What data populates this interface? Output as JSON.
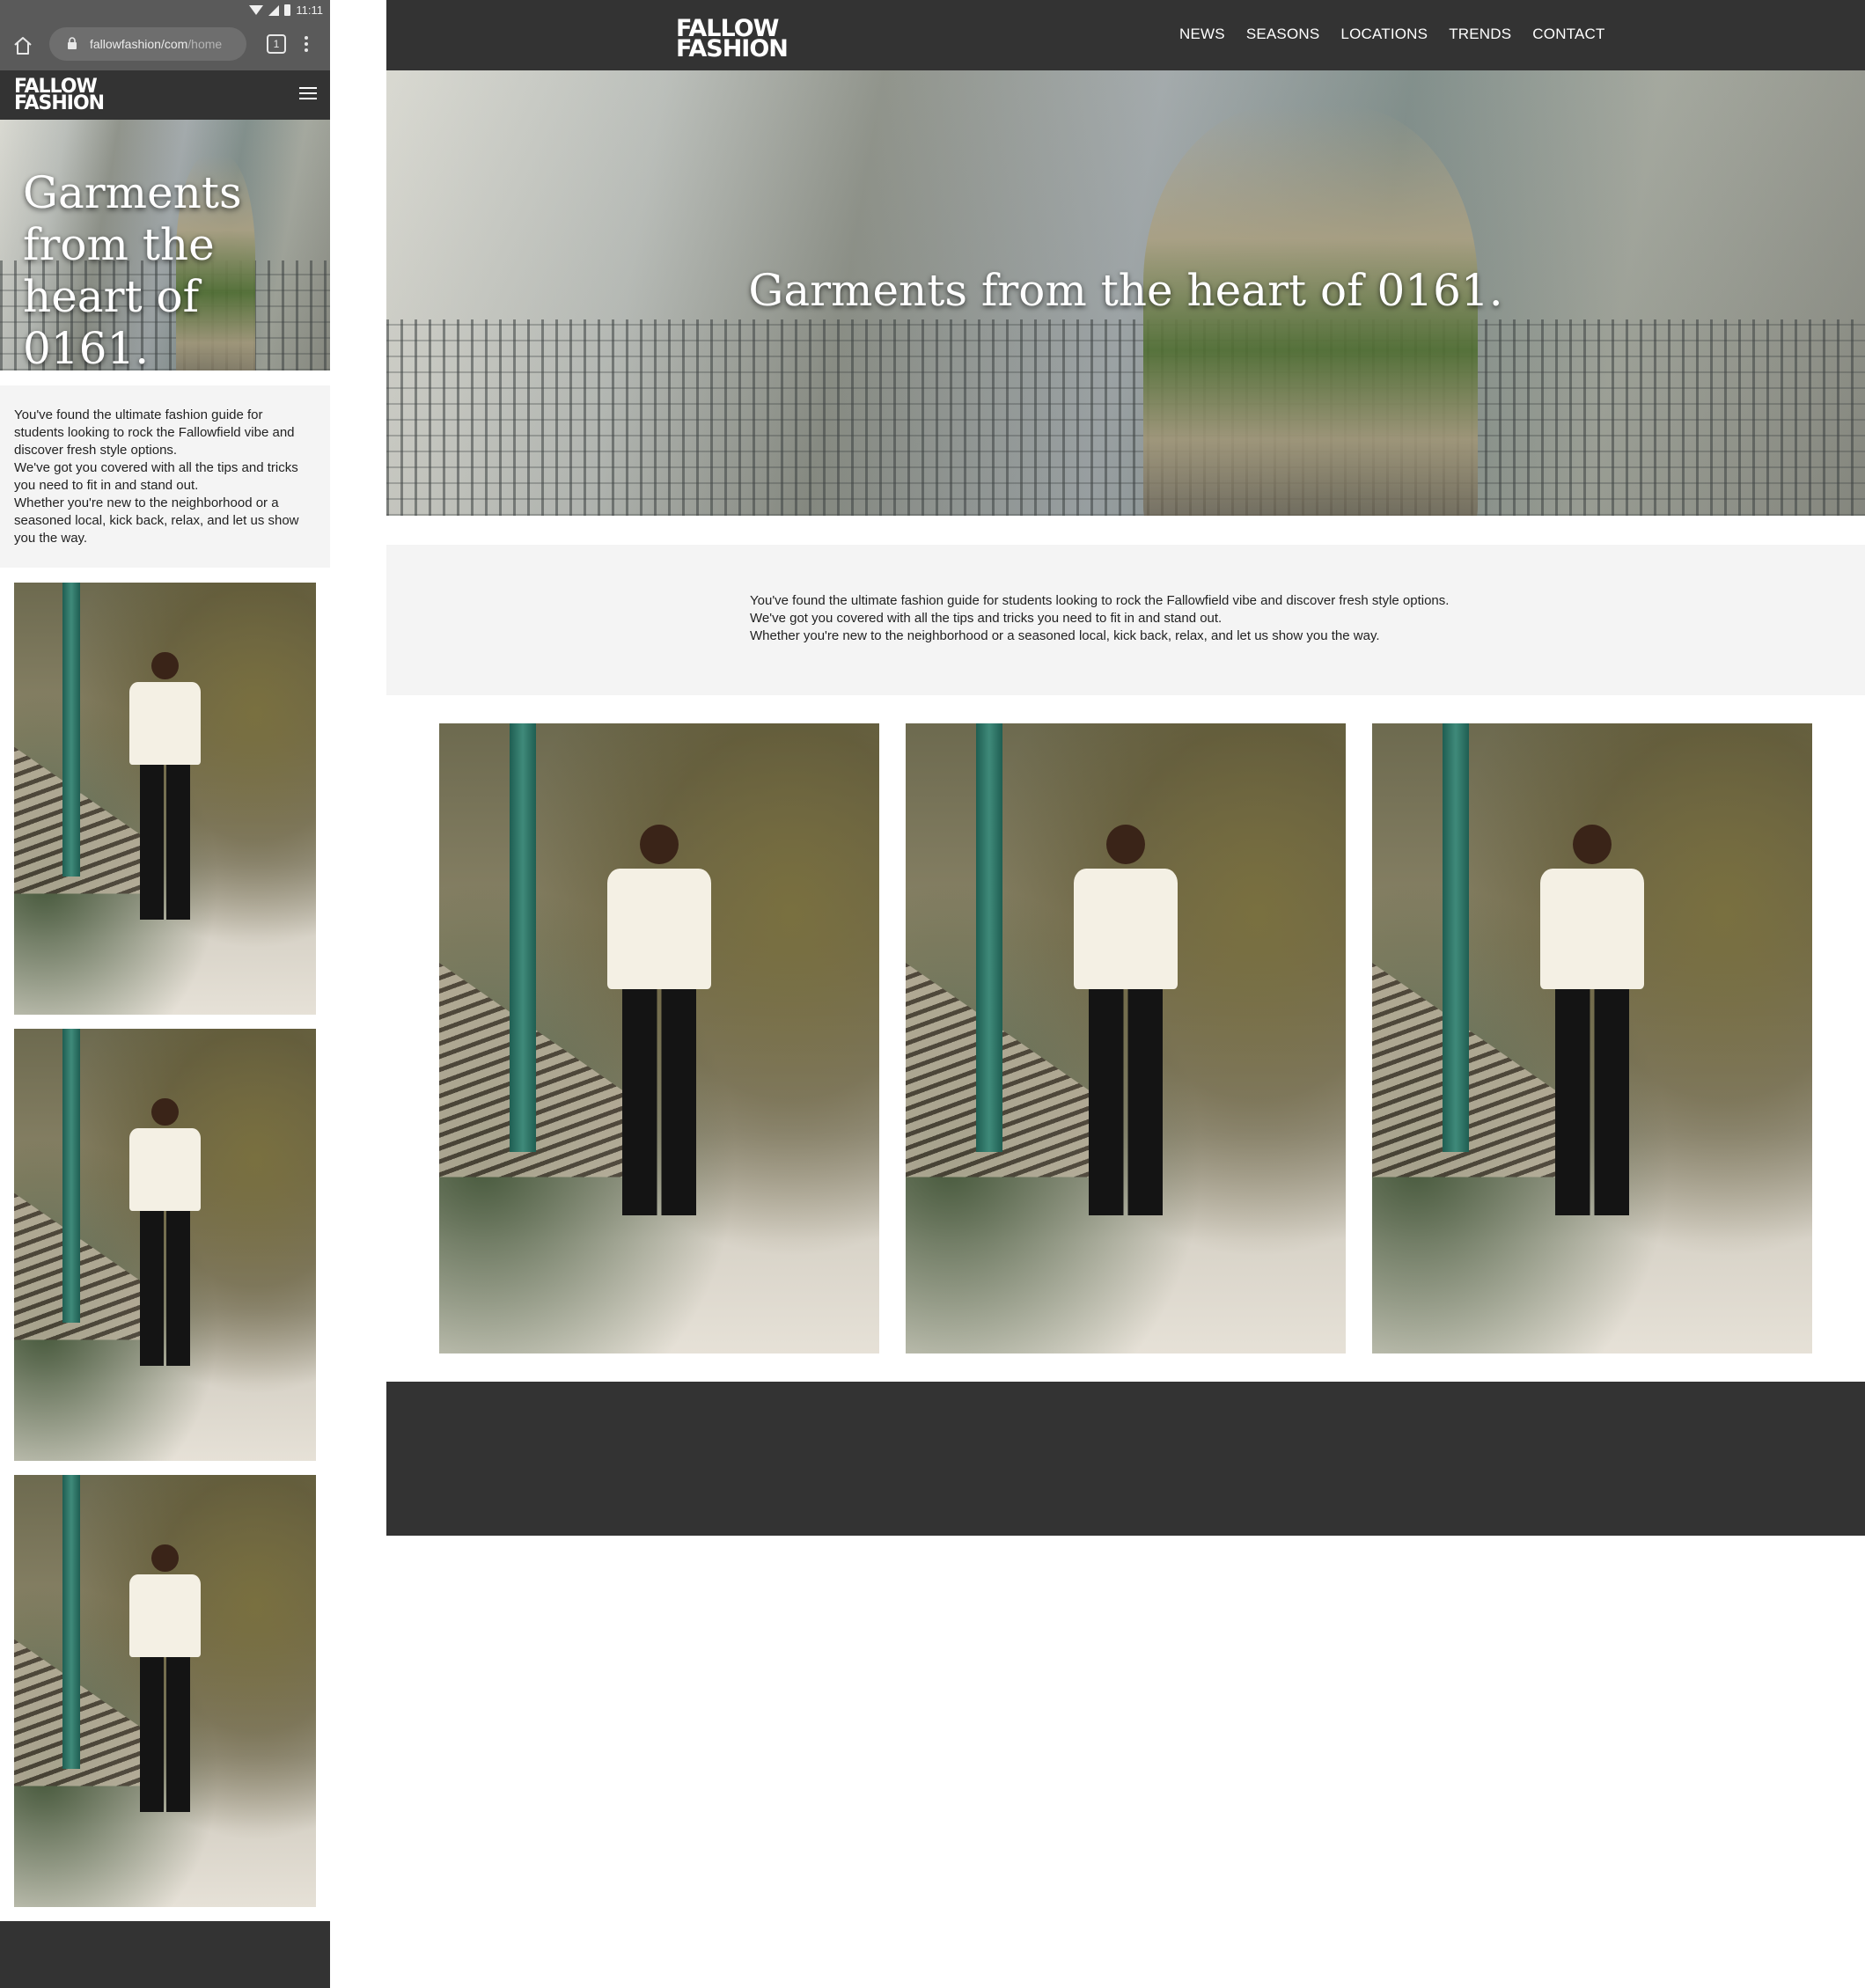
{
  "status_bar": {
    "time": "11:11"
  },
  "browser": {
    "url_host": "fallowfashion/com",
    "url_path": "/home",
    "tab_count": "1"
  },
  "brand": {
    "line1": "FALLOW",
    "line2": "FASHION"
  },
  "nav": {
    "items": [
      {
        "label": "NEWS"
      },
      {
        "label": "SEASONS"
      },
      {
        "label": "LOCATIONS"
      },
      {
        "label": "TRENDS"
      },
      {
        "label": "CONTACT"
      }
    ]
  },
  "hero": {
    "title": "Garments from the heart of 0161.",
    "mobile_lines": [
      "Garments",
      "from the",
      "heart of 0161."
    ]
  },
  "intro": {
    "lines": [
      "You've found the ultimate fashion guide for students looking to rock the Fallowfield vibe and discover fresh style options.",
      "We've got you covered with all the tips and tricks you need to fit in and stand out.",
      "Whether you're new to the neighborhood or a seasoned local, kick back, relax, and let us show you the way."
    ]
  },
  "gallery": {
    "count": 3
  }
}
